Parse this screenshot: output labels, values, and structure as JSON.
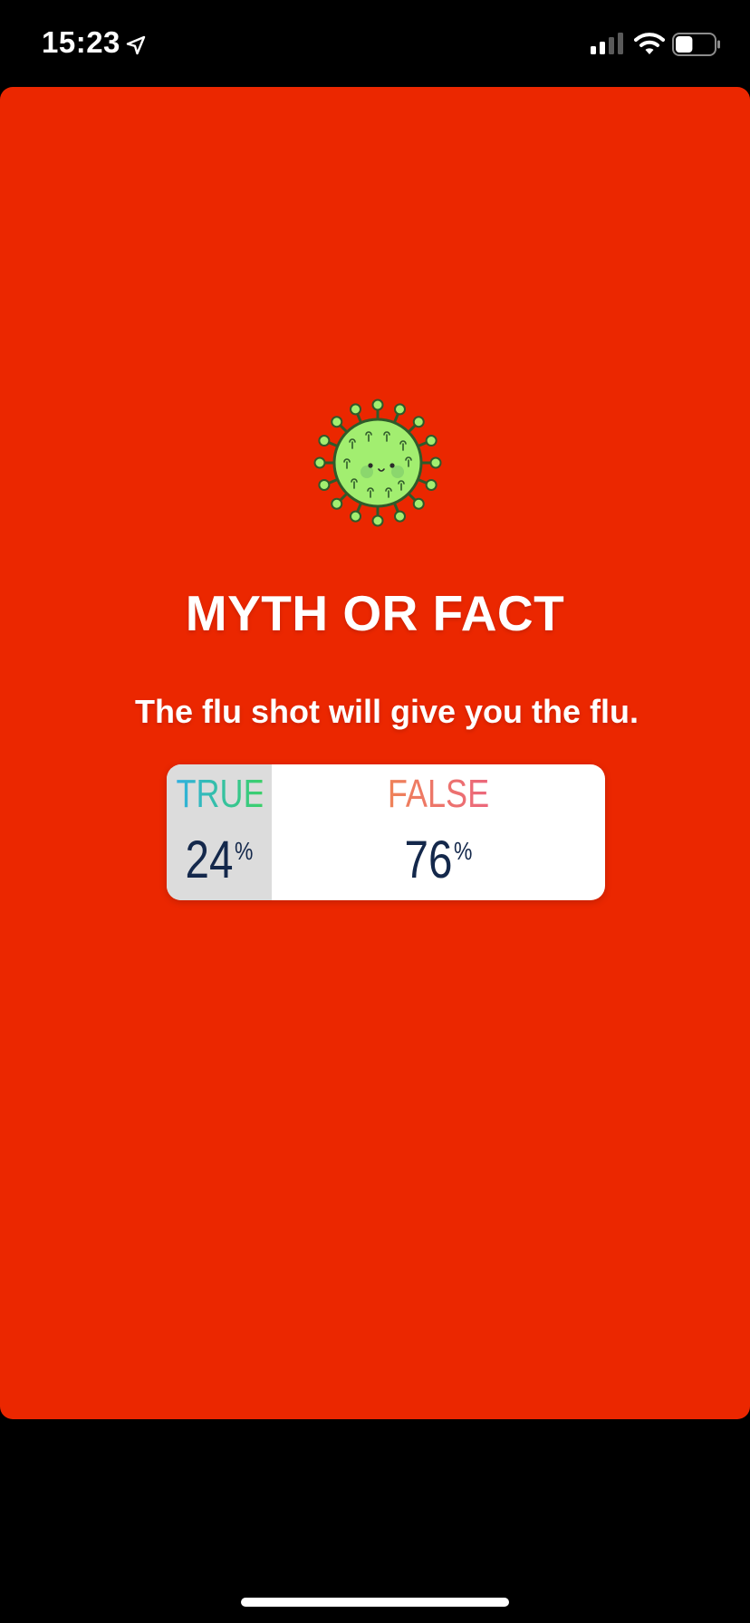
{
  "status_bar": {
    "time": "15:23",
    "icons": [
      "location-arrow-icon",
      "cellular-signal-icon",
      "wifi-icon",
      "battery-icon"
    ],
    "signal_bars": 2,
    "battery_level": 0.45
  },
  "story": {
    "background_color": "#eb2700",
    "sticker": "virus-icon",
    "title": "MYTH OR FACT",
    "question": "The flu shot will give you the flu."
  },
  "poll": {
    "options": [
      {
        "label": "TRUE",
        "percent": "24",
        "percent_sign": "%",
        "share": 0.24
      },
      {
        "label": "FALSE",
        "percent": "76",
        "percent_sign": "%",
        "share": 0.76
      }
    ],
    "colors": {
      "true_gradient": [
        "#2fb0e0",
        "#3cd06a"
      ],
      "false_gradient": [
        "#f29a3a",
        "#e8509a"
      ],
      "percent_text": "#14284b"
    }
  }
}
